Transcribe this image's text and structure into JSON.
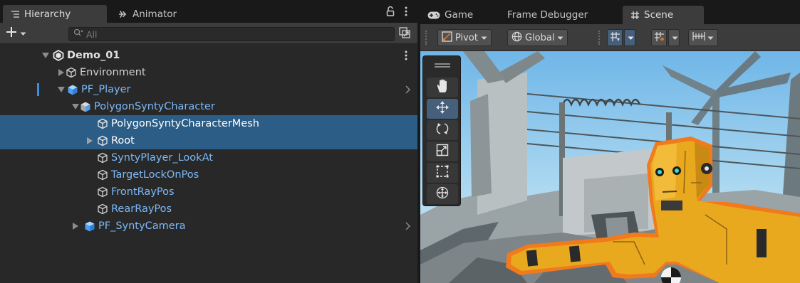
{
  "hierarchy": {
    "tabs": [
      {
        "label": "Hierarchy",
        "icon": "list-icon"
      },
      {
        "label": "Animator",
        "icon": "animator-icon"
      }
    ],
    "search_placeholder": "All",
    "rows": [
      {
        "label": "Demo_01",
        "icon": "unity-scene-icon"
      },
      {
        "label": "Environment",
        "icon": "gameobject-cube-icon"
      },
      {
        "label": "PF_Player",
        "icon": "prefab-cube-icon"
      },
      {
        "label": "PolygonSyntyCharacter",
        "icon": "prefab-cube-icon"
      },
      {
        "label": "PolygonSyntyCharacterMesh",
        "icon": "gameobject-cube-icon"
      },
      {
        "label": "Root",
        "icon": "gameobject-cube-icon"
      },
      {
        "label": "SyntyPlayer_LookAt",
        "icon": "gameobject-cube-icon"
      },
      {
        "label": "TargetLockOnPos",
        "icon": "gameobject-cube-icon"
      },
      {
        "label": "FrontRayPos",
        "icon": "gameobject-cube-icon"
      },
      {
        "label": "RearRayPos",
        "icon": "gameobject-cube-icon"
      },
      {
        "label": "PF_SyntyCamera",
        "icon": "prefab-cube-icon"
      }
    ]
  },
  "scene": {
    "tabs": [
      {
        "label": "Game",
        "icon": "gamepad-icon"
      },
      {
        "label": "Frame Debugger",
        "icon": ""
      },
      {
        "label": "Scene",
        "icon": "hash-icon"
      }
    ],
    "toolbar": {
      "pivot_label": "Pivot",
      "global_label": "Global"
    },
    "tools": [
      "hand-tool-icon",
      "move-tool-icon",
      "rotate-tool-icon",
      "scale-tool-icon",
      "rect-tool-icon",
      "transform-tool-icon"
    ]
  },
  "colors": {
    "selection": "#2c5d87",
    "prefab_text": "#7cb8f7",
    "outline": "#f07a1c",
    "robot": "#e8a91f"
  }
}
